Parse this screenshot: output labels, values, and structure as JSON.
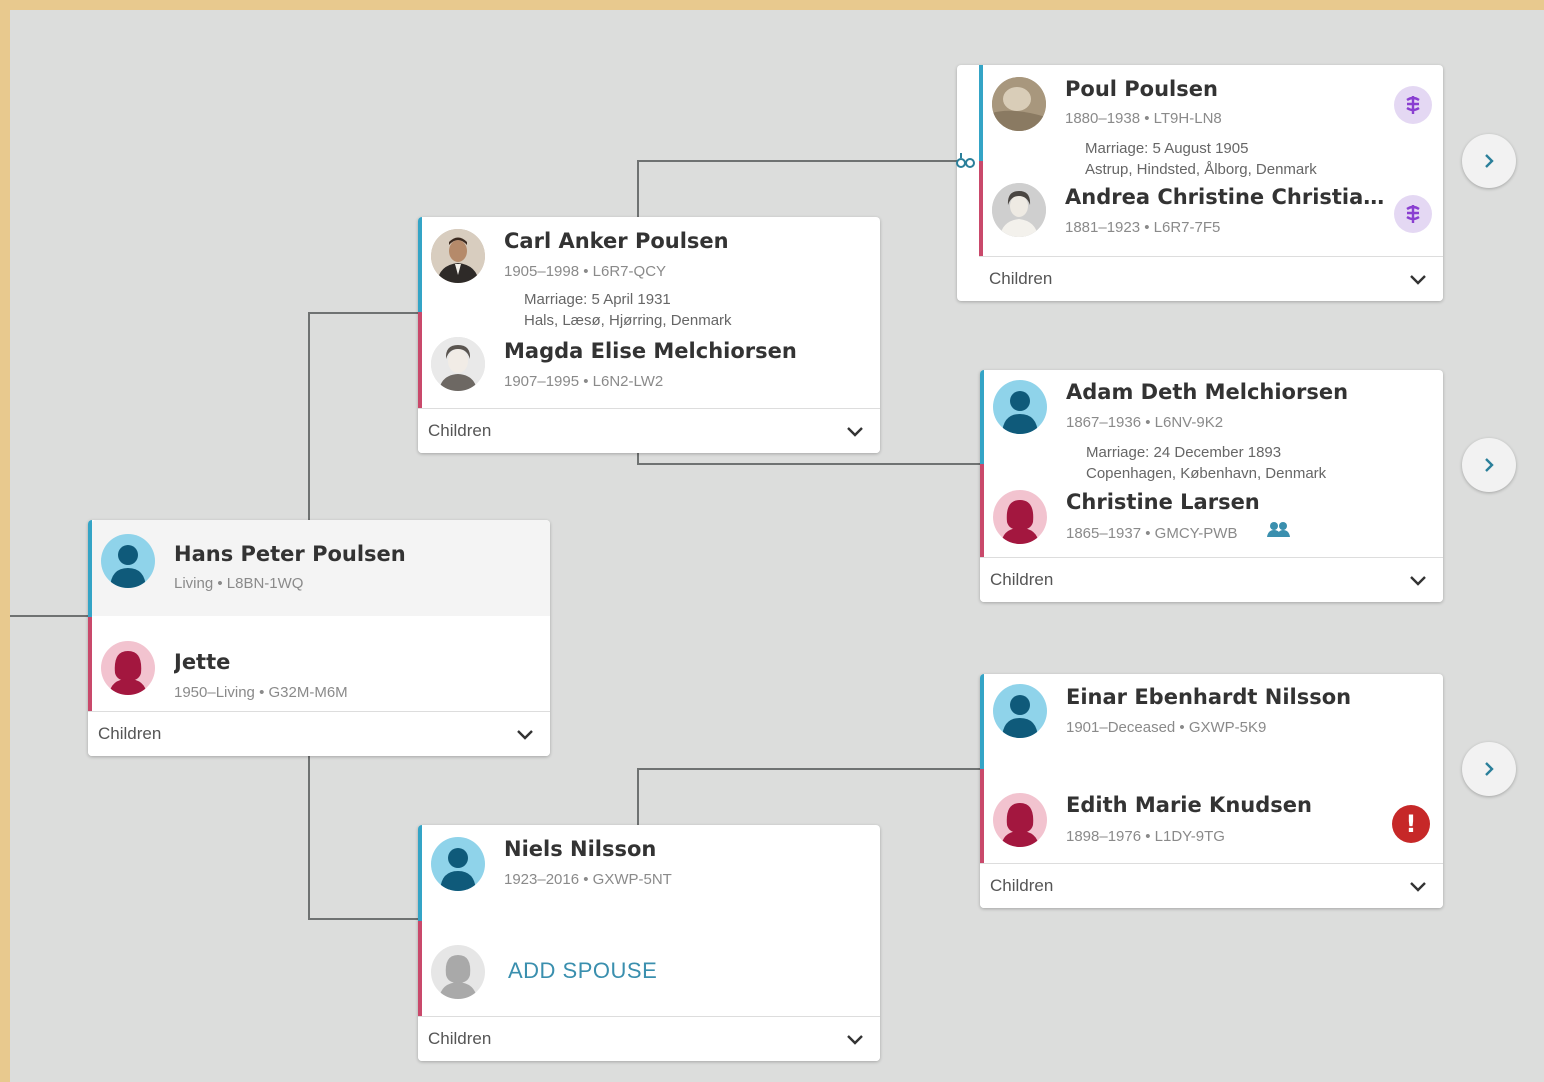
{
  "colors": {
    "male": "#34a4c6",
    "female": "#c9496b",
    "background": "#dcdddc",
    "link": "#3a8fae"
  },
  "common": {
    "children_label": "Children",
    "add_spouse_label": "ADD SPOUSE"
  },
  "root": {
    "husband": {
      "name": "Hans Peter Poulsen",
      "dates": "Living • L8BN-1WQ",
      "avatar": "male-silhouette"
    },
    "wife": {
      "name": "Jette",
      "dates": "1950–Living • G32M-M6M",
      "avatar": "female-silhouette"
    }
  },
  "paternal": {
    "husband": {
      "name": "Carl Anker Poulsen",
      "dates": "1905–1998 • L6R7-QCY",
      "avatar": "photo"
    },
    "marriage": {
      "date": "Marriage: 5 April 1931",
      "place": "Hals, Læsø, Hjørring, Denmark"
    },
    "wife": {
      "name": "Magda Elise Melchiorsen",
      "dates": "1907–1995 • L6N2-LW2",
      "avatar": "photo"
    }
  },
  "maternal": {
    "husband": {
      "name": "Niels Nilsson",
      "dates": "1923–2016 • GXWP-5NT",
      "avatar": "male-silhouette"
    },
    "wife": {
      "avatar": "empty-silhouette"
    }
  },
  "pp_grandparents": {
    "husband": {
      "name": "Poul Poulsen",
      "dates": "1880–1938 • LT9H-LN8",
      "avatar": "photo"
    },
    "marriage": {
      "date": "Marriage: 5 August 1905",
      "place": "Astrup, Hindsted, Ålborg, Denmark"
    },
    "wife": {
      "name": "Andrea Christine Christians...",
      "dates": "1881–1923 • L6R7-7F5",
      "avatar": "photo"
    }
  },
  "pm_grandparents": {
    "husband": {
      "name": "Adam Deth Melchiorsen",
      "dates": "1867–1936 • L6NV-9K2",
      "avatar": "male-silhouette"
    },
    "marriage": {
      "date": "Marriage: 24 December 1893",
      "place": "Copenhagen, København, Denmark"
    },
    "wife": {
      "name": "Christine Larsen",
      "dates": "1865–1937 • GMCY-PWB",
      "avatar": "female-silhouette"
    }
  },
  "mp_grandparents": {
    "husband": {
      "name": "Einar Ebenhardt Nilsson",
      "dates": "1901–Deceased • GXWP-5K9",
      "avatar": "male-silhouette"
    },
    "wife": {
      "name": "Edith Marie Knudsen",
      "dates": "1898–1976 • L1DY-9TG",
      "avatar": "female-silhouette",
      "alert": "!"
    }
  }
}
